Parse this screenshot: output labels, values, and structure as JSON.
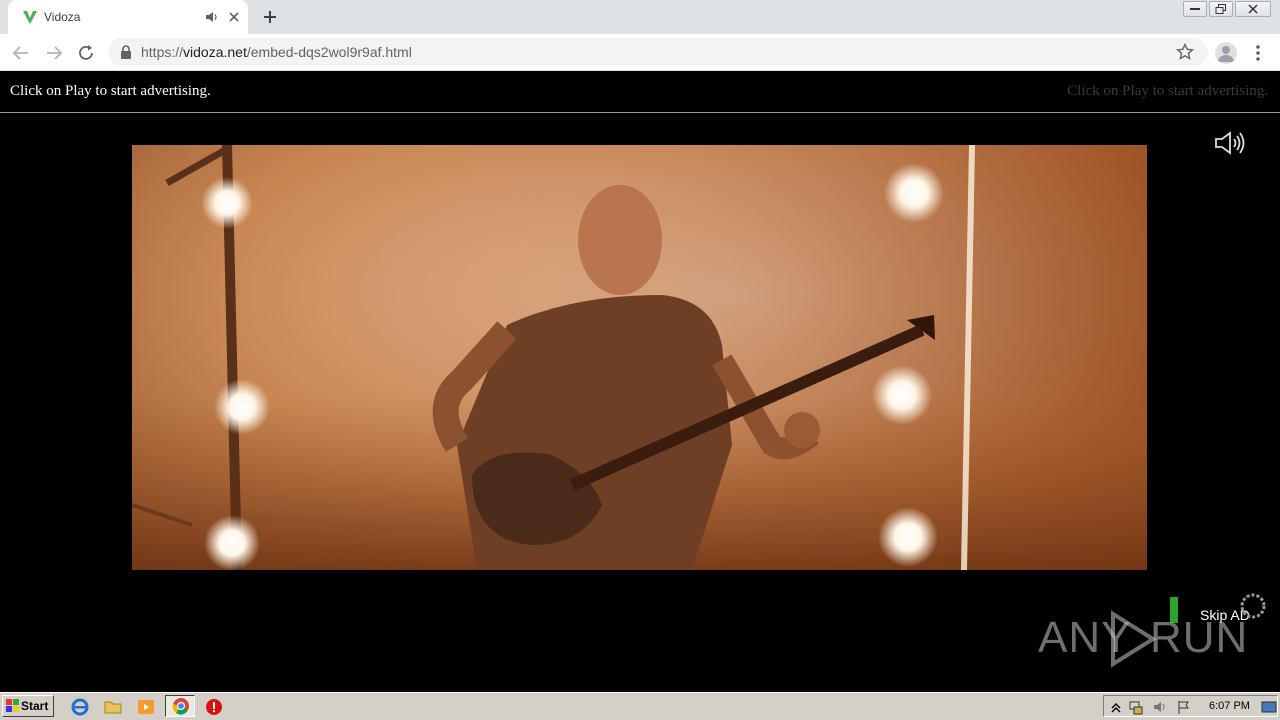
{
  "browser": {
    "tab": {
      "title": "Vidoza",
      "favicon": "vidoza-v-logo",
      "audio_icon": "speaker-icon",
      "close_icon": "close-icon"
    },
    "new_tab_icon": "plus-icon",
    "nav": {
      "back_icon": "arrow-left-icon",
      "forward_icon": "arrow-right-icon",
      "reload_icon": "reload-icon"
    },
    "address": {
      "scheme": "https://",
      "host": "vidoza.net",
      "path": "/embed-dqs2wol9r9af.html"
    },
    "bookmark_icon": "star-icon",
    "profile_icon": "avatar-icon",
    "menu_icon": "kebab-menu-icon",
    "window_controls": [
      "minimize",
      "restore",
      "close"
    ]
  },
  "page": {
    "ad_bar": {
      "left_text": "Click on Play to start advertising.",
      "right_text": "Click on Play to start advertising."
    },
    "sound_icon": "volume-icon",
    "video": {
      "description_icon": "concert-video-frame"
    },
    "skip": {
      "label": "Skip AD",
      "indicator_color": "#2aa52a"
    },
    "watermark": {
      "left": "ANY",
      "right": "RUN"
    }
  },
  "taskbar": {
    "start_label": "Start",
    "pinned": [
      "internet-explorer-icon",
      "folder-icon",
      "media-player-icon",
      "chrome-icon",
      "stop-icon"
    ],
    "clock": "6:07 PM"
  }
}
